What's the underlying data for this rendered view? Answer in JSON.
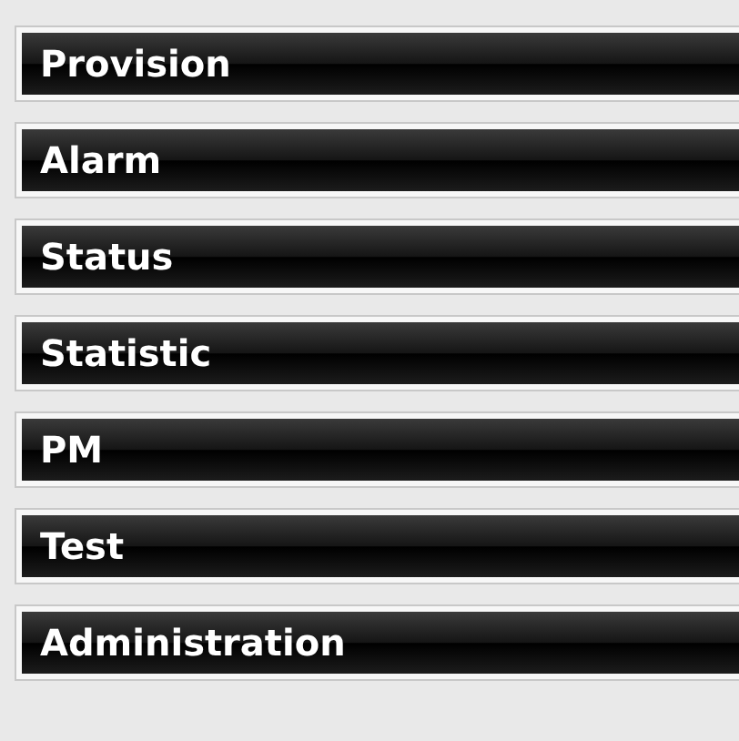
{
  "menu": {
    "items": [
      {
        "label": "Provision"
      },
      {
        "label": "Alarm"
      },
      {
        "label": "Status"
      },
      {
        "label": "Statistic"
      },
      {
        "label": "PM"
      },
      {
        "label": "Test"
      },
      {
        "label": "Administration"
      }
    ]
  }
}
